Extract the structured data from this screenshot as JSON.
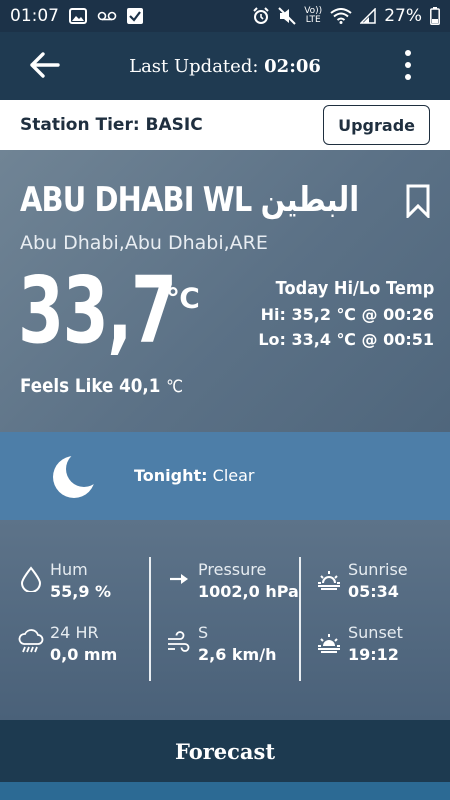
{
  "status_bar": {
    "time": "01:07",
    "battery": "27%",
    "icons": [
      "image-icon",
      "voicemail-icon",
      "checkbox-icon",
      "alarm-icon",
      "mute-icon",
      "volte-icon",
      "wifi-icon",
      "signal-icon",
      "battery-icon"
    ],
    "volte_top": "Vo))",
    "volte_bottom": "LTE"
  },
  "app_bar": {
    "last_updated_label": "Last Updated:",
    "last_updated_time": "02:06"
  },
  "tier_bar": {
    "tier_text": "Station Tier: BASIC",
    "upgrade_label": "Upgrade"
  },
  "station": {
    "name": "ABU DHABI WL البطين",
    "location": "Abu Dhabi,Abu Dhabi,ARE",
    "temperature": "33,7",
    "temperature_unit": "℃",
    "feels_like_label": "Feels Like 40,1",
    "feels_like_unit": "℃",
    "today_title": "Today Hi/Lo Temp",
    "hi": "Hi: 35,2 ℃ @ 00:26",
    "lo": "Lo: 33,4 ℃ @ 00:51"
  },
  "tonight": {
    "label": "Tonight:",
    "condition": "Clear"
  },
  "details": {
    "humidity": {
      "label": "Hum",
      "value": "55,9 %"
    },
    "rain": {
      "label": "24 HR",
      "value": "0,0 mm"
    },
    "pressure": {
      "label": "Pressure",
      "value": "1002,0 hPa"
    },
    "wind": {
      "label": "S",
      "value": "2,6 km/h"
    },
    "sunrise": {
      "label": "Sunrise",
      "value": "05:34"
    },
    "sunset": {
      "label": "Sunset",
      "value": "19:12"
    }
  },
  "forecast_label": "Forecast",
  "colors": {
    "appbar": "#1f3a51",
    "tonight_band": "#4d7ea8",
    "hero": "#5b7186"
  }
}
